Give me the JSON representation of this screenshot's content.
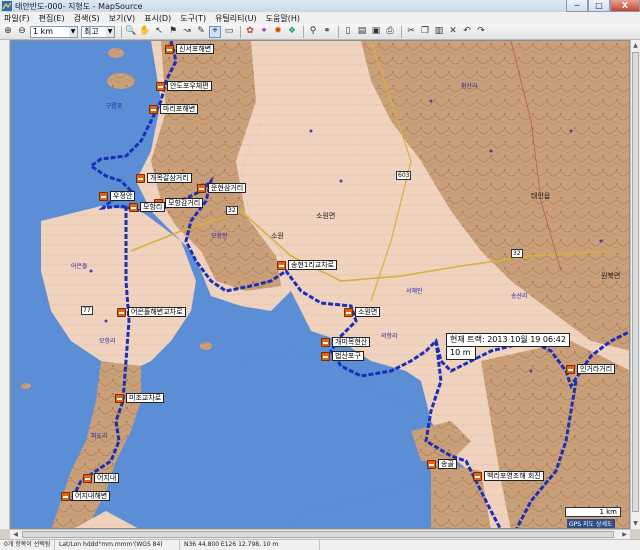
{
  "title": "태안반도-000- 지형도 - MapSource",
  "window_buttons": {
    "min": "─",
    "max": "□",
    "close": "X"
  },
  "menu": [
    "파일(F)",
    "편집(E)",
    "검색(S)",
    "보기(V)",
    "표시(D)",
    "도구(T)",
    "유틸리티(U)",
    "도움말(H)"
  ],
  "toolbar": {
    "zoom_value": "1 km",
    "detail_value": "최고",
    "icons": [
      "zoom-in",
      "zoom-out",
      "zoom-tool",
      "hand-tool",
      "select-tool",
      "waypoint-tool",
      "route-tool",
      "track-tool",
      "measure-tool",
      "pointer-tool",
      "ruler",
      "poi-1",
      "poi-2",
      "poi-3",
      "poi-4",
      "find",
      "find-near",
      "new",
      "open",
      "save",
      "print",
      "cut",
      "copy",
      "paste",
      "delete",
      "undo",
      "redo"
    ]
  },
  "waypoints": [
    {
      "label": "신서포해변"
    },
    {
      "label": "안도포우체편"
    },
    {
      "label": "마리포해변"
    },
    {
      "label": "개목갈삼거리"
    },
    {
      "label": "운현삼거리"
    },
    {
      "label": "우정안"
    },
    {
      "label": "모항감거리"
    },
    {
      "label": "모항리"
    },
    {
      "label": "송현1리교차로"
    },
    {
      "label": "어은돌해변교차로"
    },
    {
      "label": "소원면"
    },
    {
      "label": "개미목현산"
    },
    {
      "label": "법산포구"
    },
    {
      "label": "미조교차로"
    },
    {
      "label": "어지내"
    },
    {
      "label": "어지내해변"
    },
    {
      "label": "송골"
    },
    {
      "label": "백리포영조해 회진"
    },
    {
      "label": "인거라거리"
    }
  ],
  "map_labels": {
    "towns": [
      "소원면",
      "소원",
      "만리포",
      "모항항",
      "태안읍",
      "청산리",
      "원북면",
      "송산리",
      "서해안",
      "구름포",
      "어은돌",
      "의항리",
      "모항리",
      "파도리"
    ],
    "roads": [
      "32",
      "32",
      "603",
      "77"
    ]
  },
  "track_info": {
    "line1": "현재 트랙: 2013 10월 19 06:42",
    "line2": "10 m"
  },
  "scale": "1 km",
  "gps_note": "GPS 지도 상세도",
  "status": {
    "selection": "0개 항목이 선택됨",
    "coord_format": "Lat/Lon hddd°mm.mmm'(WGS 84)",
    "position": "N36 44.800 E126 12.798, 10 m"
  }
}
